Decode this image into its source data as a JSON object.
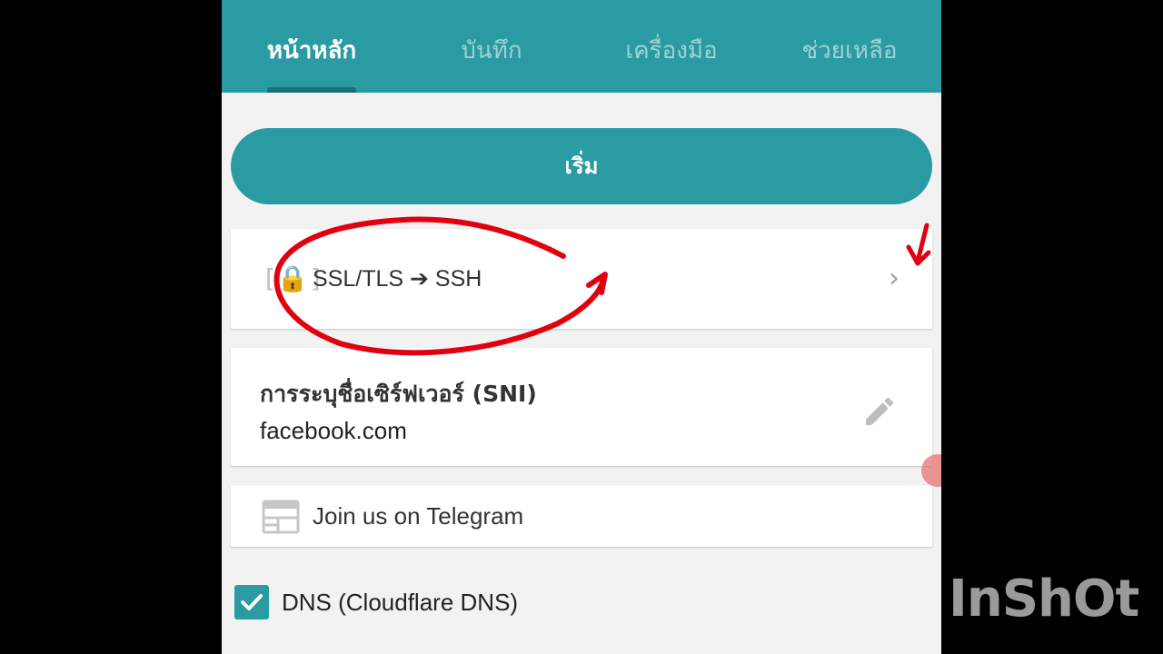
{
  "tabs": [
    {
      "label": "หน้าหลัก",
      "active": true
    },
    {
      "label": "บันทึก",
      "active": false
    },
    {
      "label": "เครื่องมือ",
      "active": false
    },
    {
      "label": "ช่วยเหลือ",
      "active": false
    }
  ],
  "start_button": {
    "label": "เริ่ม"
  },
  "protocol_card": {
    "label": "SSL/TLS ➔ SSH",
    "icon": "bracket-lock-icon",
    "chevron": "›"
  },
  "sni_card": {
    "title": "การระบุชื่อเซิร์ฟเวอร์ (SNI)",
    "value": "facebook.com",
    "icon": "pencil-icon"
  },
  "telegram_card": {
    "label": "Join us on Telegram",
    "icon": "news-icon"
  },
  "dns": {
    "label": "DNS (Cloudflare DNS)",
    "checked": true
  },
  "watermark": "InShOt",
  "colors": {
    "accent": "#2a9ba3",
    "annotation": "#e00010"
  }
}
